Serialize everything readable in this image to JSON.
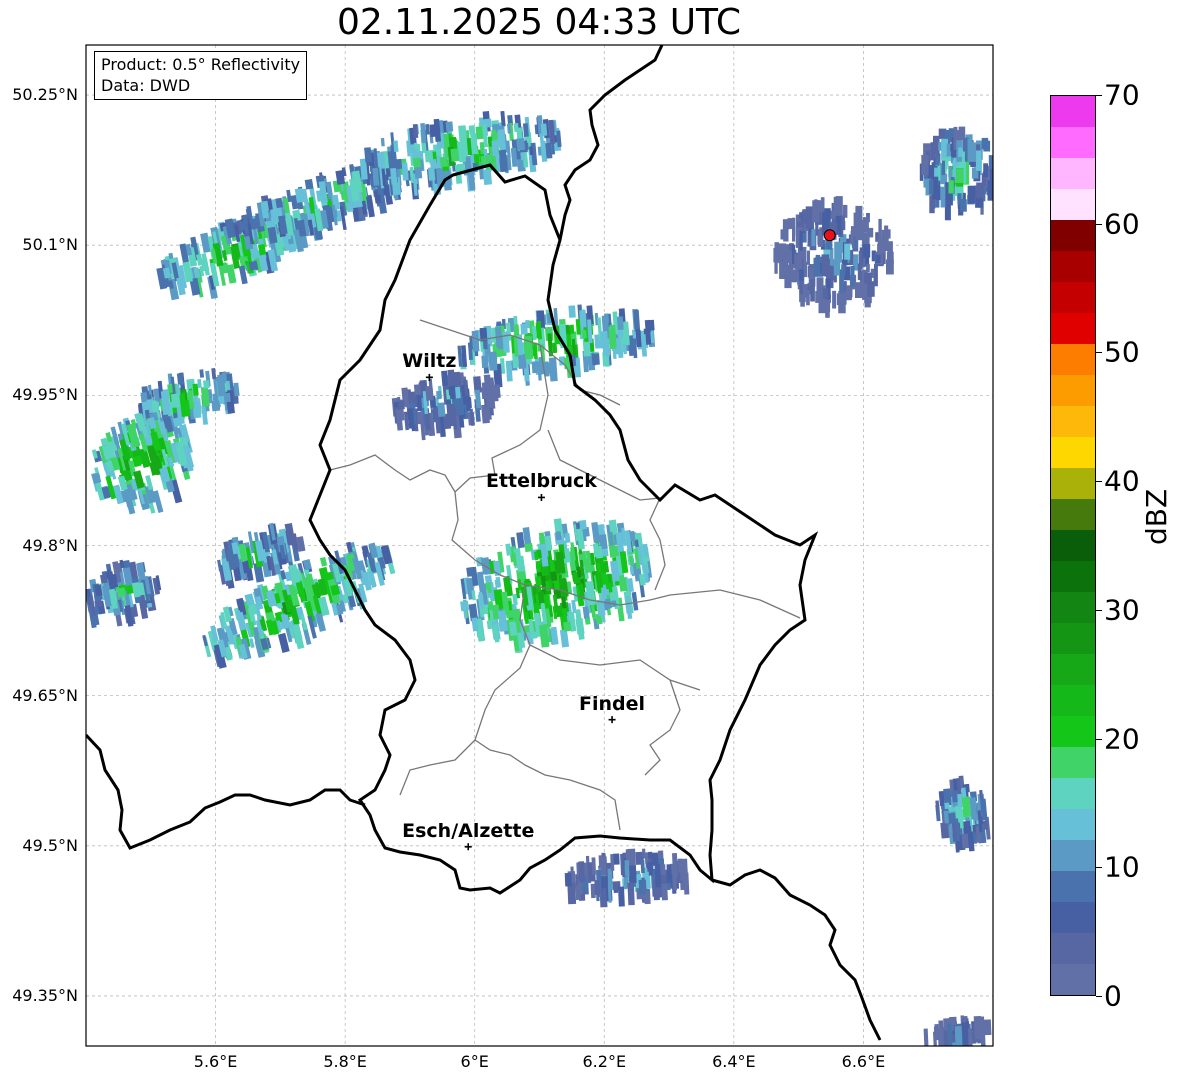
{
  "title": "02.11.2025 04:33 UTC",
  "infobox": {
    "line1": "Product: 0.5° Reflectivity",
    "line2": "Data: DWD"
  },
  "map": {
    "lon_range": [
      5.4,
      6.8
    ],
    "lat_range": [
      49.3,
      50.3
    ],
    "lat_ticks": [
      {
        "value": 50.25,
        "label": "50.25°N"
      },
      {
        "value": 50.1,
        "label": "50.1°N"
      },
      {
        "value": 49.95,
        "label": "49.95°N"
      },
      {
        "value": 49.8,
        "label": "49.8°N"
      },
      {
        "value": 49.65,
        "label": "49.65°N"
      },
      {
        "value": 49.5,
        "label": "49.5°N"
      },
      {
        "value": 49.35,
        "label": "49.35°N"
      }
    ],
    "lon_ticks": [
      {
        "value": 5.6,
        "label": "5.6°E"
      },
      {
        "value": 5.8,
        "label": "5.8°E"
      },
      {
        "value": 6.0,
        "label": "6°E"
      },
      {
        "value": 6.2,
        "label": "6.2°E"
      },
      {
        "value": 6.4,
        "label": "6.4°E"
      },
      {
        "value": 6.6,
        "label": "6.6°E"
      }
    ],
    "grid": true,
    "cities": [
      {
        "name": "Wiltz",
        "lon": 5.93,
        "lat": 49.968
      },
      {
        "name": "Ettelbruck",
        "lon": 6.103,
        "lat": 49.848
      },
      {
        "name": "Findel",
        "lon": 6.212,
        "lat": 49.626
      },
      {
        "name": "Esch/Alzette",
        "lon": 5.99,
        "lat": 49.499
      }
    ],
    "radar_site": {
      "lon": 6.548,
      "lat": 50.11,
      "color": "#e8131a"
    },
    "echo_regions": [
      {
        "lon": 5.62,
        "lat": 50.1,
        "rx": 0.12,
        "ry": 0.025,
        "rot": -22,
        "level": 24
      },
      {
        "lon": 5.76,
        "lat": 50.15,
        "rx": 0.14,
        "ry": 0.022,
        "rot": -18,
        "level": 20
      },
      {
        "lon": 5.97,
        "lat": 50.2,
        "rx": 0.16,
        "ry": 0.03,
        "rot": -10,
        "level": 22
      },
      {
        "lon": 5.55,
        "lat": 49.955,
        "rx": 0.08,
        "ry": 0.02,
        "rot": -12,
        "level": 22
      },
      {
        "lon": 5.48,
        "lat": 49.89,
        "rx": 0.08,
        "ry": 0.04,
        "rot": -30,
        "level": 26
      },
      {
        "lon": 5.72,
        "lat": 49.75,
        "rx": 0.16,
        "ry": 0.03,
        "rot": -28,
        "level": 24
      },
      {
        "lon": 5.66,
        "lat": 49.8,
        "rx": 0.07,
        "ry": 0.018,
        "rot": -20,
        "level": 20
      },
      {
        "lon": 5.45,
        "lat": 49.76,
        "rx": 0.06,
        "ry": 0.025,
        "rot": -20,
        "level": 18
      },
      {
        "lon": 6.12,
        "lat": 49.77,
        "rx": 0.15,
        "ry": 0.055,
        "rot": -15,
        "level": 26
      },
      {
        "lon": 6.12,
        "lat": 50.01,
        "rx": 0.15,
        "ry": 0.028,
        "rot": -8,
        "level": 24
      },
      {
        "lon": 5.95,
        "lat": 49.95,
        "rx": 0.08,
        "ry": 0.025,
        "rot": -10,
        "level": 14
      },
      {
        "lon": 6.23,
        "lat": 49.475,
        "rx": 0.1,
        "ry": 0.022,
        "rot": -5,
        "level": 14
      },
      {
        "lon": 6.55,
        "lat": 50.1,
        "rx": 0.09,
        "ry": 0.05,
        "rot": 0,
        "level": 12
      },
      {
        "lon": 6.74,
        "lat": 50.18,
        "rx": 0.06,
        "ry": 0.04,
        "rot": 0,
        "level": 18
      },
      {
        "lon": 6.75,
        "lat": 49.54,
        "rx": 0.04,
        "ry": 0.03,
        "rot": -10,
        "level": 18
      },
      {
        "lon": 6.74,
        "lat": 49.32,
        "rx": 0.05,
        "ry": 0.012,
        "rot": -5,
        "level": 10
      }
    ]
  },
  "colorbar": {
    "label": "dBZ",
    "min": 0,
    "max": 70,
    "tick_values": [
      0,
      10,
      20,
      30,
      40,
      50,
      60,
      70
    ],
    "ticks": [
      "0",
      "10",
      "20",
      "30",
      "40",
      "50",
      "60",
      "70"
    ],
    "colors": [
      "#6270a8",
      "#5667a4",
      "#4760a4",
      "#4a72ac",
      "#5a9ac4",
      "#66c0d8",
      "#5ed3c0",
      "#40d468",
      "#14c618",
      "#14b818",
      "#16a816",
      "#149614",
      "#128512",
      "#0c720c",
      "#0a5e0a",
      "#467a0c",
      "#aab20a",
      "#fed600",
      "#fdb80a",
      "#fd9c00",
      "#fd7d00",
      "#e00000",
      "#c40000",
      "#a80000",
      "#800000",
      "#ffe2ff",
      "#ffb6ff",
      "#ff6aff",
      "#ee3aee"
    ]
  }
}
